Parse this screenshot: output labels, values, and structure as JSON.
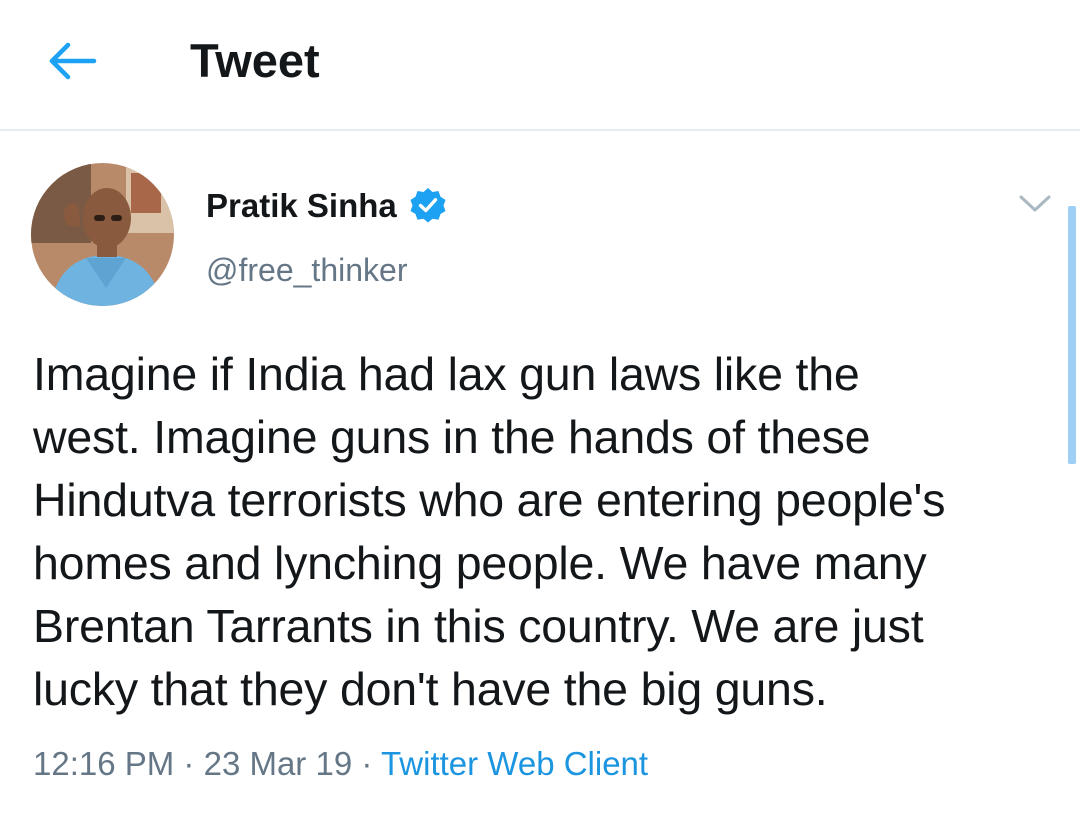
{
  "header": {
    "title": "Tweet",
    "back_icon": "arrow-left-icon",
    "accent_color": "#1da1f2"
  },
  "tweet": {
    "author": {
      "display_name": "Pratik Sinha",
      "handle": "@free_thinker",
      "verified": true,
      "verified_icon": "verified-badge-icon"
    },
    "text": "Imagine if India had lax gun laws like the\nwest. Imagine guns in the hands of these\nHindutva terrorists who are entering people's\nhomes and lynching people. We have many\nBrentan Tarrants in this country. We are just\nlucky that they don't have the big guns.",
    "time": "12:16 PM",
    "separator": "·",
    "date": "23 Mar 19",
    "client": "Twitter Web Client",
    "menu_icon": "chevron-down-icon"
  },
  "colors": {
    "text_primary": "#14171a",
    "text_secondary": "#657786",
    "link": "#1b95e0",
    "divider": "#e6ecf0"
  }
}
